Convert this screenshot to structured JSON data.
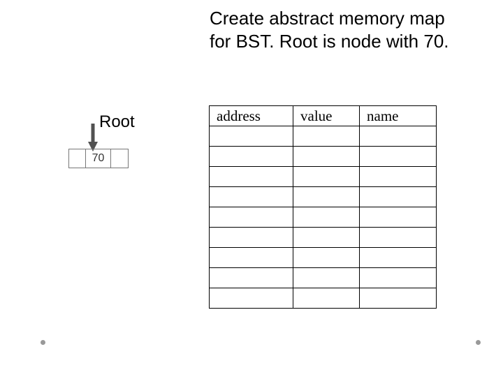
{
  "title_line1": "Create abstract memory map",
  "title_line2": "for BST. Root is node with 70.",
  "root_label": "Root",
  "node_value": "70",
  "table": {
    "headers": [
      "address",
      "value",
      "name"
    ],
    "rows": [
      [
        "",
        "",
        ""
      ],
      [
        "",
        "",
        ""
      ],
      [
        "",
        "",
        ""
      ],
      [
        "",
        "",
        ""
      ],
      [
        "",
        "",
        ""
      ],
      [
        "",
        "",
        ""
      ],
      [
        "",
        "",
        ""
      ],
      [
        "",
        "",
        ""
      ],
      [
        "",
        "",
        ""
      ]
    ]
  }
}
